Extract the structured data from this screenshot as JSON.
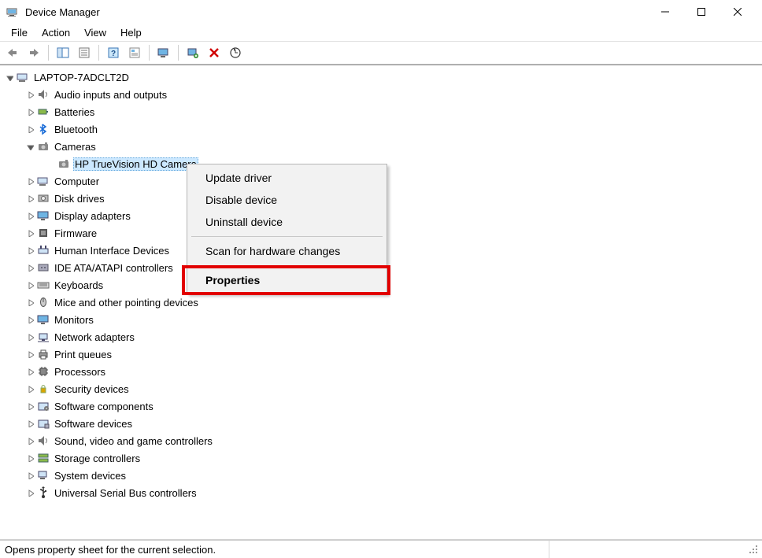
{
  "window": {
    "title": "Device Manager"
  },
  "menu": {
    "file": "File",
    "action": "Action",
    "view": "View",
    "help": "Help"
  },
  "toolbar": {
    "back": "back",
    "forward": "forward",
    "show_hide": "show-hide-console-tree",
    "properties": "properties",
    "help": "help",
    "topic": "help-topic",
    "monitor": "monitor",
    "update": "scan-hardware",
    "delete": "uninstall",
    "refresh": "refresh"
  },
  "tree": {
    "root": {
      "label": "LAPTOP-7ADCLT2D",
      "expanded": true
    },
    "items": [
      {
        "label": "Audio inputs and outputs",
        "icon": "speaker"
      },
      {
        "label": "Batteries",
        "icon": "battery"
      },
      {
        "label": "Bluetooth",
        "icon": "bluetooth"
      },
      {
        "label": "Cameras",
        "icon": "camera",
        "expanded": true,
        "children": [
          {
            "label": "HP TrueVision HD Camera",
            "icon": "camera",
            "selected": true
          }
        ]
      },
      {
        "label": "Computer",
        "icon": "computer"
      },
      {
        "label": "Disk drives",
        "icon": "disk"
      },
      {
        "label": "Display adapters",
        "icon": "display"
      },
      {
        "label": "Firmware",
        "icon": "firmware"
      },
      {
        "label": "Human Interface Devices",
        "icon": "hid"
      },
      {
        "label": "IDE ATA/ATAPI controllers",
        "icon": "ide"
      },
      {
        "label": "Keyboards",
        "icon": "keyboard"
      },
      {
        "label": "Mice and other pointing devices",
        "icon": "mouse"
      },
      {
        "label": "Monitors",
        "icon": "monitor"
      },
      {
        "label": "Network adapters",
        "icon": "network"
      },
      {
        "label": "Print queues",
        "icon": "printer"
      },
      {
        "label": "Processors",
        "icon": "cpu"
      },
      {
        "label": "Security devices",
        "icon": "security"
      },
      {
        "label": "Software components",
        "icon": "software-comp"
      },
      {
        "label": "Software devices",
        "icon": "software-dev"
      },
      {
        "label": "Sound, video and game controllers",
        "icon": "sound"
      },
      {
        "label": "Storage controllers",
        "icon": "storage"
      },
      {
        "label": "System devices",
        "icon": "system"
      },
      {
        "label": "Universal Serial Bus controllers",
        "icon": "usb"
      }
    ]
  },
  "context_menu": {
    "items": [
      {
        "label": "Update driver"
      },
      {
        "label": "Disable device"
      },
      {
        "label": "Uninstall device"
      },
      {
        "sep": true
      },
      {
        "label": "Scan for hardware changes"
      },
      {
        "sep": true
      },
      {
        "label": "Properties",
        "bold": true,
        "highlight": true
      }
    ]
  },
  "status": {
    "text": "Opens property sheet for the current selection."
  }
}
